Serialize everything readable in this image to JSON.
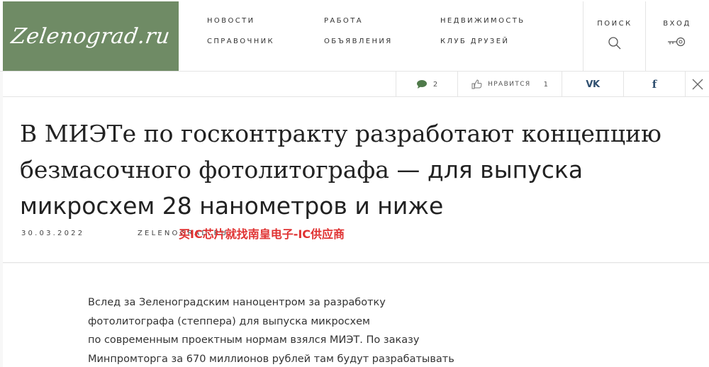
{
  "logo": {
    "text": "Zelenograd.ru"
  },
  "nav": {
    "news": "НОВОСТИ",
    "jobs": "РАБОТА",
    "realty": "НЕДВИЖИМОСТЬ",
    "directory": "СПРАВОЧНИК",
    "ads": "ОБЪЯВЛЕНИЯ",
    "club": "КЛУБ ДРУЗЕЙ"
  },
  "tools": {
    "search_label": "ПОИСК",
    "search_icon": "search-icon",
    "login_label": "ВХОД",
    "login_icon": "key-icon"
  },
  "sharebar": {
    "comments_count": "2",
    "likes_label": "НРАВИТСЯ",
    "likes_count": "1",
    "vk_label": "VK",
    "fb_label": "f",
    "close_icon": "close-icon"
  },
  "article": {
    "title_line1": "В МИЭТе по госконтракту разработают концепцию",
    "title_line2_serif": "безмасочного фотолитографа",
    "title_line2_sans": " — для выпуска",
    "title_line3": "микросхем 28 нанометров и ниже",
    "date": "30.03.2022",
    "author": "ZELENOGRAD.RU",
    "watermark": "买IC芯片就找南皇电子-IC供应商",
    "paragraph_lines": [
      "Вслед за Зеленоградским наноцентром за разработку",
      "фотолитографа (степпера) для выпуска микросхем",
      "по современным проектным нормам взялся МИЭТ. По заказу",
      "Минпромторга за 670 миллионов рублей там будут разрабатывать"
    ]
  },
  "colors": {
    "logo_bg": "#6f8b65",
    "accent_text": "#2f4f6f",
    "watermark": "#e03232"
  }
}
